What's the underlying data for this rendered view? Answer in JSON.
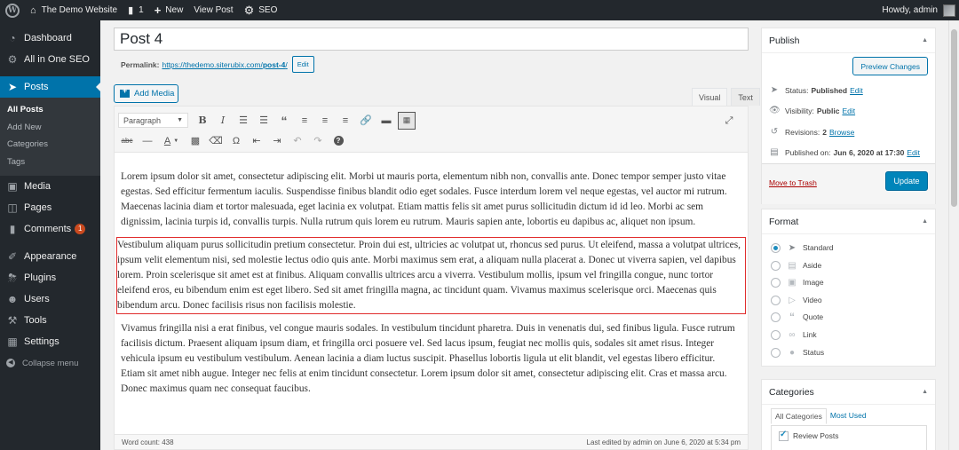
{
  "adminbar": {
    "site_name": "The Demo Website",
    "comments_count": "1",
    "new_label": "New",
    "view_post_label": "View Post",
    "seo_label": "SEO",
    "howdy": "Howdy, admin"
  },
  "sidebar": {
    "items": [
      {
        "label": "Dashboard",
        "icon": "dashboard-icon"
      },
      {
        "label": "All in One SEO",
        "icon": "seo-icon"
      },
      {
        "label": "Posts",
        "icon": "pin-icon"
      },
      {
        "label": "Media",
        "icon": "media-icon"
      },
      {
        "label": "Pages",
        "icon": "pages-icon"
      },
      {
        "label": "Comments",
        "icon": "comments-icon",
        "badge": "1"
      },
      {
        "label": "Appearance",
        "icon": "appearance-icon"
      },
      {
        "label": "Plugins",
        "icon": "plugins-icon"
      },
      {
        "label": "Users",
        "icon": "users-icon"
      },
      {
        "label": "Tools",
        "icon": "tools-icon"
      },
      {
        "label": "Settings",
        "icon": "settings-icon"
      }
    ],
    "posts_submenu": [
      "All Posts",
      "Add New",
      "Categories",
      "Tags"
    ],
    "collapse_label": "Collapse menu"
  },
  "post": {
    "title": "Post 4",
    "permalink_label": "Permalink:",
    "permalink_base": "https://thedemo.siterubix.com/",
    "permalink_slug": "post-4",
    "permalink_tail": "/",
    "edit_label": "Edit",
    "add_media_label": "Add Media"
  },
  "editor": {
    "tabs": [
      "Visual",
      "Text"
    ],
    "format_select": "Paragraph",
    "paragraphs": [
      "Lorem ipsum dolor sit amet, consectetur adipiscing elit. Morbi ut mauris porta, elementum nibh non, convallis ante. Donec tempor semper justo vitae egestas. Sed efficitur fermentum iaculis. Suspendisse finibus blandit odio eget sodales. Fusce interdum lorem vel neque egestas, vel auctor mi rutrum. Maecenas lacinia diam et tortor malesuada, eget lacinia ex volutpat. Etiam mattis felis sit amet purus sollicitudin dictum id id leo. Morbi ac sem dignissim, lacinia turpis id, convallis turpis. Nulla rutrum quis lorem eu rutrum. Mauris sapien ante, lobortis eu dapibus ac, aliquet non ipsum.",
      "Vestibulum aliquam purus sollicitudin pretium consectetur. Proin dui est, ultricies ac volutpat ut, rhoncus sed purus. Ut eleifend, massa a volutpat ultrices, ipsum velit elementum nisi, sed molestie lectus odio quis ante. Morbi maximus sem erat, a aliquam nulla placerat a. Donec ut viverra sapien, vel dapibus lorem. Proin scelerisque sit amet est at finibus. Aliquam convallis ultrices arcu a viverra. Vestibulum mollis, ipsum vel fringilla congue, nunc tortor eleifend eros, eu bibendum enim est eget libero. Sed sit amet fringilla magna, ac tincidunt quam. Vivamus maximus scelerisque orci. Maecenas quis bibendum arcu. Donec facilisis risus non facilisis molestie.",
      "Vivamus fringilla nisi a erat finibus, vel congue mauris sodales. In vestibulum tincidunt pharetra. Duis in venenatis dui, sed finibus ligula. Fusce rutrum facilisis dictum. Praesent aliquam ipsum diam, et fringilla orci posuere vel. Sed lacus ipsum, feugiat nec mollis quis, sodales sit amet risus. Integer vehicula ipsum eu vestibulum vestibulum. Aenean lacinia a diam luctus suscipit. Phasellus lobortis ligula ut elit blandit, vel egestas libero efficitur. Etiam sit amet nibh augue. Integer nec felis at enim tincidunt consectetur. Lorem ipsum dolor sit amet, consectetur adipiscing elit. Cras et massa arcu. Donec maximus quam nec consequat faucibus."
    ],
    "word_count": "Word count: 438",
    "last_edited": "Last edited by admin on June 6, 2020 at 5:34 pm"
  },
  "publish": {
    "title": "Publish",
    "preview_label": "Preview Changes",
    "status_label": "Status:",
    "status_value": "Published",
    "visibility_label": "Visibility:",
    "visibility_value": "Public",
    "revisions_label": "Revisions:",
    "revisions_value": "2",
    "browse_label": "Browse",
    "published_label": "Published on:",
    "published_value": "Jun 6, 2020 at 17:30",
    "edit_label": "Edit",
    "trash_label": "Move to Trash",
    "update_label": "Update"
  },
  "format": {
    "title": "Format",
    "options": [
      "Standard",
      "Aside",
      "Image",
      "Video",
      "Quote",
      "Link",
      "Status"
    ],
    "selected": "Standard"
  },
  "categories": {
    "title": "Categories",
    "tabs": [
      "All Categories",
      "Most Used"
    ],
    "items": [
      "Review Posts"
    ]
  },
  "colors": {
    "accent": "#0073aa",
    "admin_bg": "#23282d",
    "highlight_border": "#e02d2d",
    "update_button": "#0085ba"
  }
}
